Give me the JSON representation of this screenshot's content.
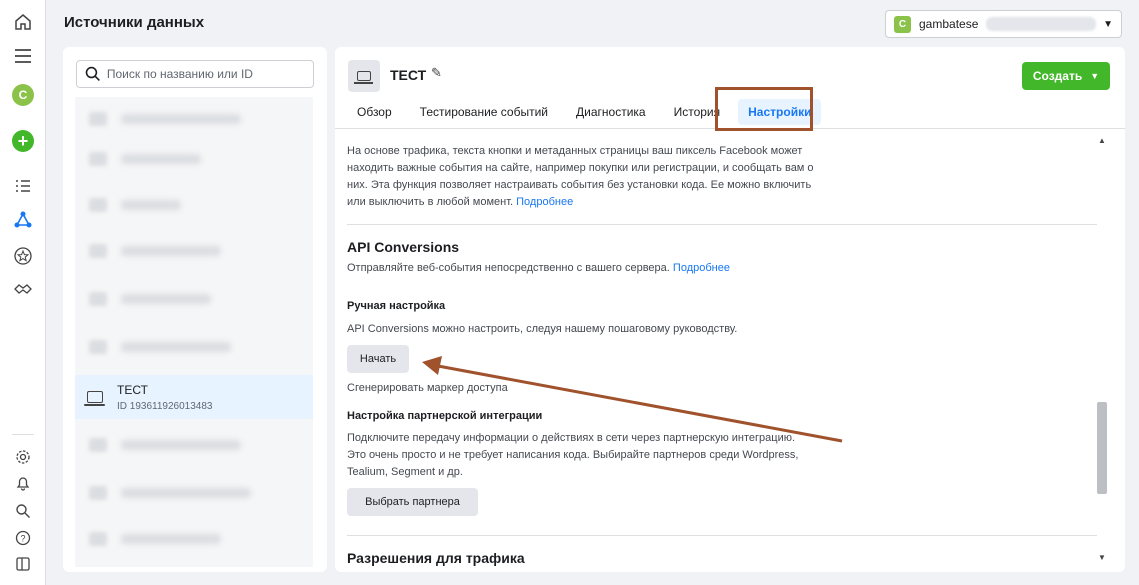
{
  "rail": {
    "avatar_letter": "C"
  },
  "header": {
    "title": "Источники данных"
  },
  "account": {
    "badge": "C",
    "name": "gambatese"
  },
  "search": {
    "placeholder": "Поиск по названию или ID"
  },
  "selected_source": {
    "name": "ТЕСТ",
    "id": "ID 193611926013483"
  },
  "source_header": {
    "name": "ТЕСТ",
    "create_label": "Создать"
  },
  "tabs": [
    {
      "label": "Обзор"
    },
    {
      "label": "Тестирование событий"
    },
    {
      "label": "Диагностика"
    },
    {
      "label": "История"
    },
    {
      "label": "Настройки"
    }
  ],
  "content": {
    "intro_text": "На основе трафика, текста кнопки и метаданных страницы ваш пиксель Facebook может находить важные события на сайте, например покупки или регистрации, и сообщать вам о них. Эта функция позволяет настраивать события без установки кода. Ее можно включить или выключить в любой момент.",
    "intro_link": "Подробнее",
    "api_title": "API Conversions",
    "api_desc": "Отправляйте веб-события непосредственно с вашего сервера.",
    "api_link": "Подробнее",
    "manual_title": "Ручная настройка",
    "manual_desc": "API Conversions можно настроить, следуя нашему пошаговому руководству.",
    "start_button": "Начать",
    "token_link": "Сгенерировать маркер доступа",
    "partner_title": "Настройка партнерской интеграции",
    "partner_desc": "Подключите передачу информации о действиях в сети через партнерскую интеграцию. Это очень просто и не требует написания кода. Выбирайте партнеров среди Wordpress, Tealium, Segment и др.",
    "partner_button": "Выбрать партнера",
    "next_section_title": "Разрешения для трафика"
  },
  "colors": {
    "accent": "#1877f2",
    "create_green": "#42b72a",
    "annotation": "#a0522d"
  }
}
